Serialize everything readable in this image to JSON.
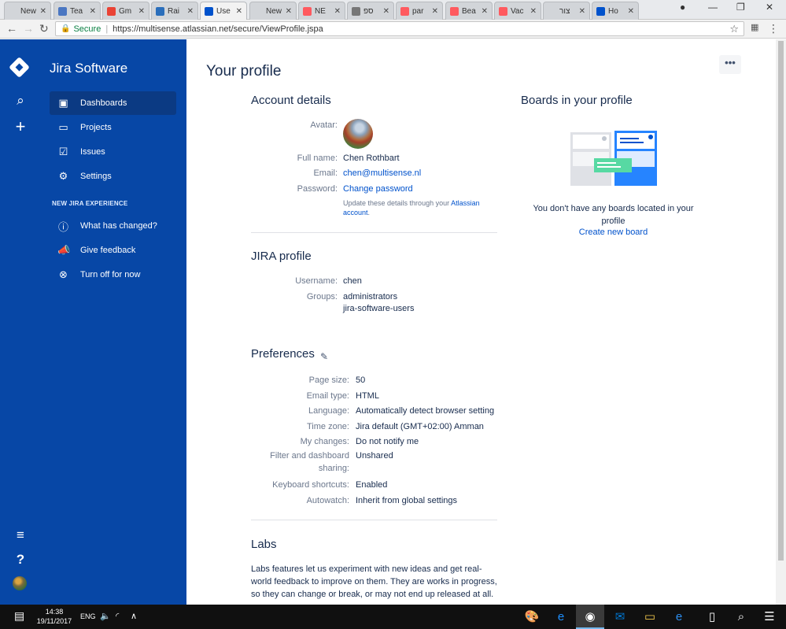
{
  "browser": {
    "tabs": [
      {
        "title": "New Ta",
        "icon": "blank-icon",
        "active": false
      },
      {
        "title": "Tea",
        "icon": "teams-icon",
        "active": false
      },
      {
        "title": "Gm",
        "icon": "google-icon",
        "active": false
      },
      {
        "title": "Rai",
        "icon": "rally-icon",
        "active": false
      },
      {
        "title": "Use",
        "icon": "jira-icon",
        "active": true
      },
      {
        "title": "New Ta",
        "icon": "blank-icon",
        "active": false
      },
      {
        "title": "NE",
        "icon": "airbnb-icon",
        "active": false
      },
      {
        "title": "ספ",
        "icon": "document-icon",
        "active": false
      },
      {
        "title": "par",
        "icon": "airbnb-icon",
        "active": false
      },
      {
        "title": "Bea",
        "icon": "airbnb-icon",
        "active": false
      },
      {
        "title": "Vac",
        "icon": "airbnb-icon",
        "active": false
      },
      {
        "title": "צור",
        "icon": "blank-icon",
        "active": false
      },
      {
        "title": "Ho",
        "icon": "atlassian-icon",
        "active": false
      }
    ],
    "close_glyph": "✕",
    "secure_label": "Secure",
    "url": "https://multisense.atlassian.net/secure/ViewProfile.jspa"
  },
  "sidebar": {
    "app_name": "Jira Software",
    "items": [
      {
        "label": "Dashboards",
        "icon": "dashboard-icon",
        "active": true
      },
      {
        "label": "Projects",
        "icon": "folder-icon",
        "active": false
      },
      {
        "label": "Issues",
        "icon": "issues-icon",
        "active": false
      },
      {
        "label": "Settings",
        "icon": "gear-icon",
        "active": false
      }
    ],
    "experience_heading": "NEW JIRA EXPERIENCE",
    "experience_items": [
      {
        "label": "What has changed?",
        "icon": "info-icon"
      },
      {
        "label": "Give feedback",
        "icon": "megaphone-icon"
      },
      {
        "label": "Turn off for now",
        "icon": "close-circle-icon"
      }
    ]
  },
  "page": {
    "title": "Your profile",
    "more_label": "•••",
    "account": {
      "title": "Account details",
      "avatar_label": "Avatar:",
      "fullname_label": "Full name:",
      "fullname": "Chen Rothbart",
      "email_label": "Email:",
      "email": "chen@multisense.nl",
      "password_label": "Password:",
      "password_link": "Change password",
      "hint_prefix": "Update these details through your ",
      "hint_link": "Atlassian account",
      "hint_suffix": "."
    },
    "jira_profile": {
      "title": "JIRA profile",
      "username_label": "Username:",
      "username": "chen",
      "groups_label": "Groups:",
      "groups": [
        "administrators",
        "jira-software-users"
      ]
    },
    "preferences": {
      "title": "Preferences",
      "rows": [
        {
          "label": "Page size:",
          "value": "50"
        },
        {
          "label": "Email type:",
          "value": "HTML"
        },
        {
          "label": "Language:",
          "value": "Automatically detect browser setting"
        },
        {
          "label": "Time zone:",
          "value": "Jira default (GMT+02:00) Amman"
        },
        {
          "label": "My changes:",
          "value": "Do not notify me"
        },
        {
          "label": "Filter and dashboard sharing:",
          "value": "Unshared"
        },
        {
          "label": "Keyboard shortcuts:",
          "value": "Enabled"
        },
        {
          "label": "Autowatch:",
          "value": "Inherit from global settings"
        }
      ]
    },
    "labs": {
      "title": "Labs",
      "text": "Labs features let us experiment with new ideas and get real-world feedback to improve on them. They are works in progress, so they can change or break, or may not end up released at all."
    },
    "boards": {
      "title": "Boards in your profile",
      "empty_text": "You don't have any boards located in your profile",
      "create_link": "Create new board"
    }
  },
  "taskbar": {
    "time": "14:38",
    "date": "19/11/2017",
    "language": "ENG"
  },
  "colors": {
    "sidebar": "#0747a6",
    "link": "#0052cc",
    "text": "#172b4d",
    "secure": "#0b8043"
  }
}
